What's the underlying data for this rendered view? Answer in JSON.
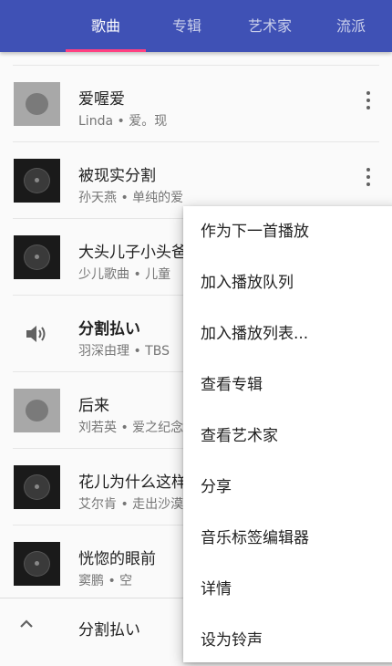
{
  "tabs": [
    {
      "label": "歌曲",
      "active": true
    },
    {
      "label": "专辑",
      "active": false
    },
    {
      "label": "艺术家",
      "active": false
    },
    {
      "label": "流派",
      "active": false
    }
  ],
  "songs": [
    {
      "title": "爱喔爱",
      "artist": "Linda",
      "album": "爱。现",
      "art": "gray"
    },
    {
      "title": "被现实分割",
      "artist": "孙天燕",
      "album": "单纯的爱",
      "art": "dark"
    },
    {
      "title": "大头儿子小头爸爸",
      "artist": "少儿歌曲",
      "album": "儿童",
      "art": "dark"
    },
    {
      "title": "分割払い",
      "artist": "羽深由理",
      "album": "TBS",
      "art": "speaker",
      "playing": true
    },
    {
      "title": "后来",
      "artist": "刘若英",
      "album": "爱之纪念",
      "art": "gray"
    },
    {
      "title": "花儿为什么这样红",
      "artist": "艾尔肯",
      "album": "走出沙漠",
      "art": "dark"
    },
    {
      "title": "恍惚的眼前",
      "artist": "窦鹏",
      "album": "空",
      "art": "dark"
    }
  ],
  "separator": " • ",
  "now_playing": {
    "title": "分割払い"
  },
  "context_menu": {
    "items": [
      "作为下一首播放",
      "加入播放队列",
      "加入播放列表...",
      "查看专辑",
      "查看艺术家",
      "分享",
      "音乐标签编辑器",
      "详情",
      "设为铃声"
    ]
  },
  "colors": {
    "toolbar": "#3f51b5",
    "indicator": "#ff4081"
  }
}
